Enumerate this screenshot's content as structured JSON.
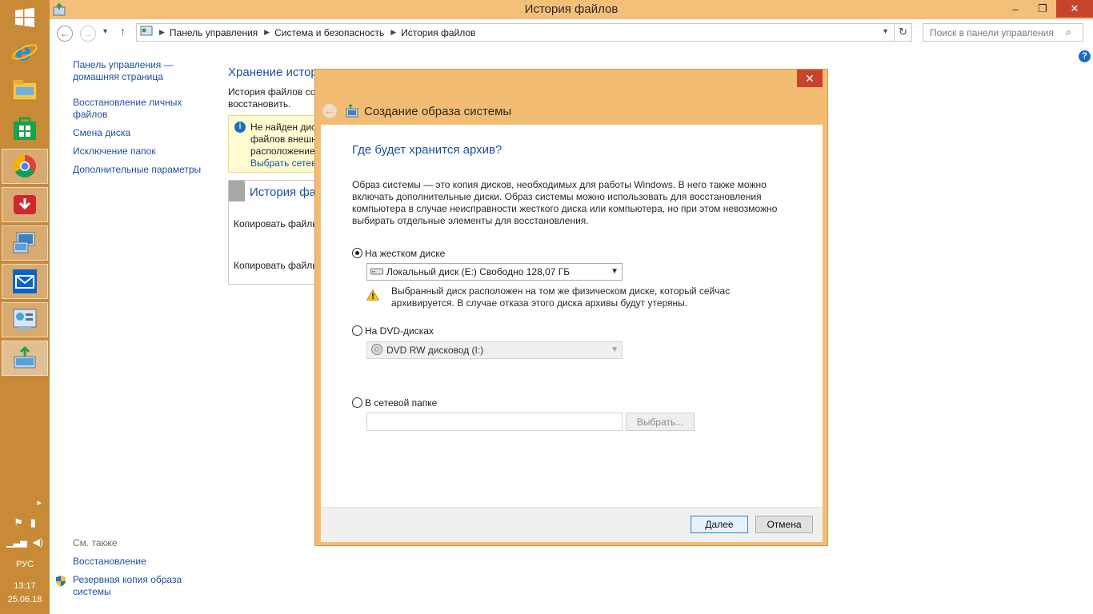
{
  "window": {
    "title": "История файлов",
    "min": "–",
    "max": "❐",
    "close": "✕"
  },
  "nav": {
    "back": "←",
    "forward": "→",
    "recent": "▾",
    "up": "↑",
    "breadcrumb": [
      "Панель управления",
      "Система и безопасность",
      "История файлов"
    ],
    "search_placeholder": "Поиск в панели управления"
  },
  "leftpane": {
    "links": [
      "Панель управления — домашняя страница",
      "Восстановление личных файлов",
      "Смена диска",
      "Исключение папок",
      "Дополнительные параметры"
    ],
    "see_also": "См. также",
    "bottom": [
      "Восстановление",
      "Резервная копия образа системы"
    ]
  },
  "main": {
    "heading": "Хранение истор",
    "text": "История файлов со\nвосстановить.",
    "info_lines": [
      "Не найден дис",
      "файлов внешн",
      "расположение"
    ],
    "info_link": "Выбрать сетев",
    "section_title": "История фа",
    "row1": "Копировать файлы",
    "row2": "Копировать файлы"
  },
  "dialog": {
    "close": "✕",
    "title": "Создание образа системы",
    "question": "Где будет хранится архив?",
    "description": "Образ системы — это копия дисков, необходимых для работы Windows. В него также можно включать дополнительные диски. Образ системы можно использовать для восстановления компьютера в случае неисправности жесткого диска или компьютера, но при этом невозможно выбирать отдельные элементы для восстановления.",
    "opt_hdd": "На жестком диске",
    "hdd_value": "Локальный диск (E:)  Свободно 128,07 ГБ",
    "warning": "Выбранный диск расположен на том же физическом диске, который сейчас архивируется. В случае отказа этого диска архивы будут утеряны.",
    "opt_dvd": "На DVD-дисках",
    "dvd_value": "DVD RW дисковод (I:)",
    "opt_net": "В сетевой папке",
    "browse": "Выбрать...",
    "next": "Далее",
    "cancel": "Отмена"
  },
  "tray": {
    "lang": "РУС",
    "time": "13:17",
    "date": "25.06.18"
  }
}
